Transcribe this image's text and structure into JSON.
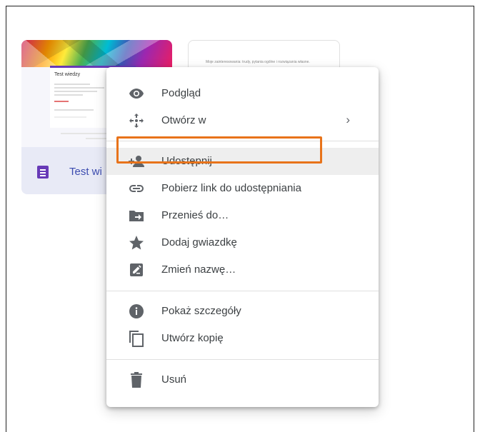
{
  "files": {
    "card1": {
      "name": "Test wi",
      "preview_title": "Test wiedzy"
    },
    "card2": {
      "preview_text": "Moje zainteresowania: trudy, pytania ogólne i rozwiązania własne."
    }
  },
  "context_menu": {
    "items": [
      {
        "label": "Podgląd",
        "icon": "eye-icon"
      },
      {
        "label": "Otwórz w",
        "icon": "move-arrows-icon",
        "submenu_indicator": "›"
      },
      {
        "label": "Udostępnij",
        "icon": "person-add-icon",
        "state": "hover"
      },
      {
        "label": "Pobierz link do udostępniania",
        "icon": "link-icon"
      },
      {
        "label": "Przenieś do…",
        "icon": "folder-move-icon"
      },
      {
        "label": "Dodaj gwiazdkę",
        "icon": "star-icon"
      },
      {
        "label": "Zmień nazwę…",
        "icon": "rename-icon"
      },
      {
        "label": "Pokaż szczegóły",
        "icon": "info-icon"
      },
      {
        "label": "Utwórz kopię",
        "icon": "copy-icon"
      },
      {
        "label": "Usuń",
        "icon": "trash-icon"
      }
    ]
  },
  "colors": {
    "highlight_border": "#e8731a",
    "icon": "#5f6368",
    "forms_purple": "#673ab7",
    "menu_hover": "#eeeeee"
  }
}
